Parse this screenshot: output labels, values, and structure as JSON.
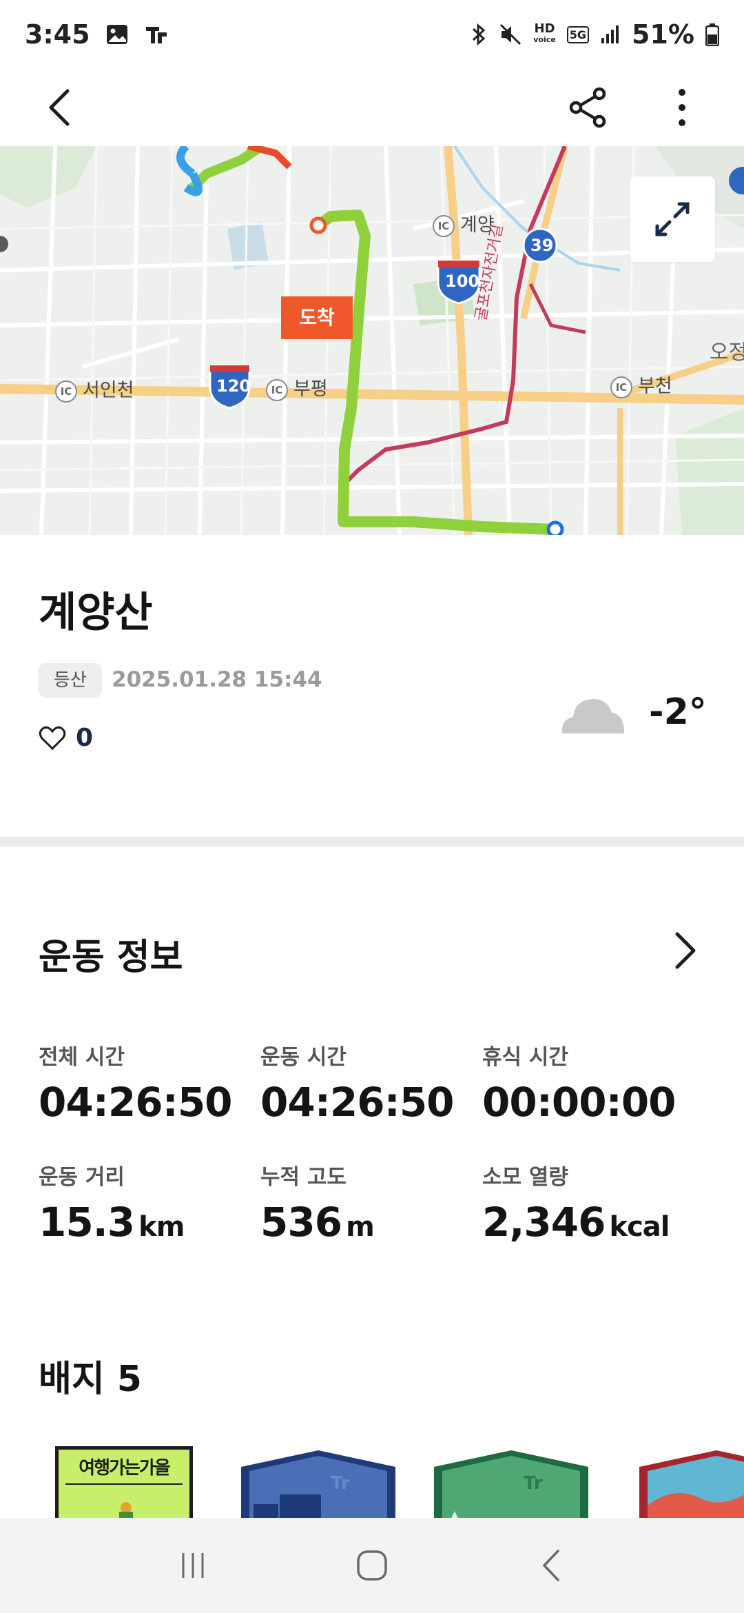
{
  "status_bar": {
    "time": "3:45",
    "battery": "51%",
    "network": "5G",
    "hd_voice": "HD"
  },
  "map": {
    "markers": {
      "arrive": "도착",
      "depart": "출발"
    },
    "labels": {
      "seoincheon": "서인천",
      "bupyeong": "부평",
      "bucheon": "부천",
      "gyeyang": "계양",
      "ojeong": "오정",
      "bike_road": "굴포천자전거길"
    },
    "highway_numbers": {
      "h120": "120",
      "h100": "100",
      "r39": "39"
    },
    "ic_badge": "IC"
  },
  "activity": {
    "title": "계양산",
    "category": "등산",
    "date": "2025.01.28 15:44",
    "likes": "0",
    "temperature": "-2°"
  },
  "exercise": {
    "section_title": "운동 정보",
    "stats": [
      {
        "label": "전체 시간",
        "value": "04:26:50",
        "unit": ""
      },
      {
        "label": "운동 시간",
        "value": "04:26:50",
        "unit": ""
      },
      {
        "label": "휴식 시간",
        "value": "00:00:00",
        "unit": ""
      },
      {
        "label": "운동 거리",
        "value": "15.3",
        "unit": "km"
      },
      {
        "label": "누적 고도",
        "value": "536",
        "unit": "m"
      },
      {
        "label": "소모 열량",
        "value": "2,346",
        "unit": "kcal"
      }
    ]
  },
  "badges": {
    "title": "배지 5",
    "first_badge_text": "여행가는가을"
  },
  "colors": {
    "route": "#8fd13a",
    "arrive": "#f0582b",
    "depart": "#1f6fe0",
    "major_road": "#f7cf86",
    "bike_road": "#c23b5b"
  }
}
